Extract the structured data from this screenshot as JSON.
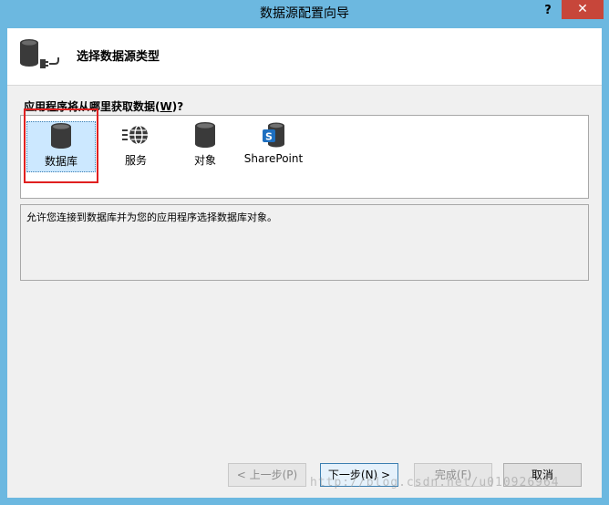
{
  "window": {
    "title": "数据源配置向导",
    "help_label": "?",
    "close_label": "✕"
  },
  "header": {
    "title": "选择数据源类型",
    "icon": "database-connect-icon"
  },
  "question": {
    "text": "应用程序将从哪里获取数据(",
    "mnemonic": "W",
    "suffix": ")?"
  },
  "options": [
    {
      "label": "数据库",
      "icon": "database-icon",
      "selected": true
    },
    {
      "label": "服务",
      "icon": "service-globe-icon",
      "selected": false
    },
    {
      "label": "对象",
      "icon": "object-icon",
      "selected": false
    },
    {
      "label": "SharePoint",
      "icon": "sharepoint-icon",
      "selected": false
    }
  ],
  "description": "允许您连接到数据库并为您的应用程序选择数据库对象。",
  "buttons": {
    "previous": "< 上一步(P)",
    "next": "下一步(N) >",
    "finish": "完成(F)",
    "cancel": "取消"
  },
  "watermark": "http://blog.csdn.net/u010926964",
  "colors": {
    "frame": "#6cb8e0",
    "close": "#c7463a",
    "highlight": "#e02020",
    "selection": "#cce8ff"
  }
}
